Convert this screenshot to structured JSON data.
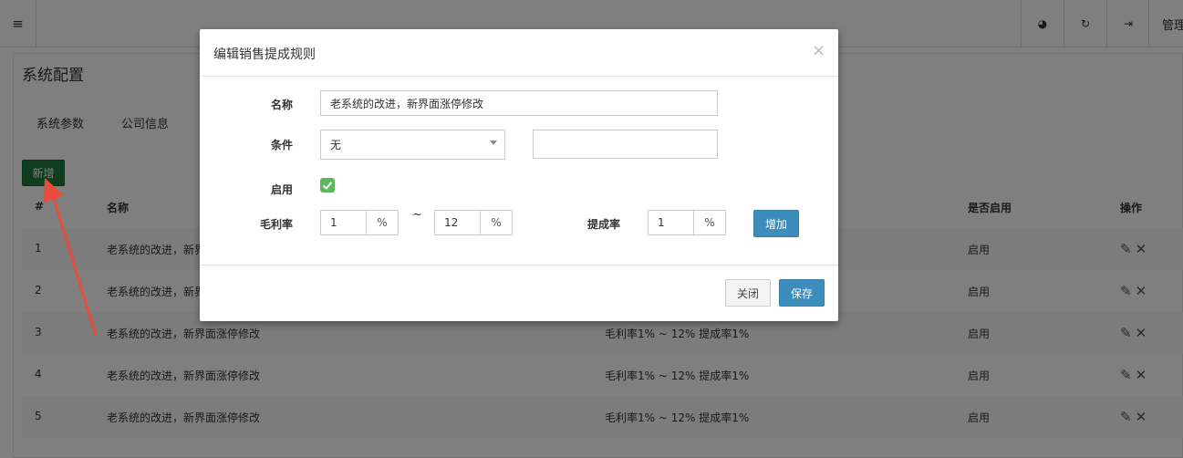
{
  "topbar": {
    "menu_icon": "menu-icon",
    "buttons": [
      {
        "icon": "pie-chart-icon",
        "glyph": "◕"
      },
      {
        "icon": "refresh-icon",
        "glyph": "↻"
      },
      {
        "icon": "logout-icon",
        "glyph": "⇥"
      }
    ],
    "admin_label": "管理"
  },
  "page": {
    "title": "系统配置",
    "tabs": [
      "系统参数",
      "公司信息"
    ],
    "add_button": "新增"
  },
  "table": {
    "headers": {
      "index": "#",
      "name": "名称",
      "enabled": "是否启用",
      "actions": "操作"
    },
    "rows": [
      {
        "index": "1",
        "name": "老系统的改进，新界面涨停修改",
        "rule": "",
        "enabled": "启用"
      },
      {
        "index": "2",
        "name": "老系统的改进，新界面涨停修改",
        "rule": "",
        "enabled": "启用"
      },
      {
        "index": "3",
        "name": "老系统的改进，新界面涨停修改",
        "rule": "毛利率1% ~ 12% 提成率1%",
        "enabled": "启用"
      },
      {
        "index": "4",
        "name": "老系统的改进，新界面涨停修改",
        "rule": "毛利率1% ~ 12% 提成率1%",
        "enabled": "启用"
      },
      {
        "index": "5",
        "name": "老系统的改进，新界面涨停修改",
        "rule": "毛利率1% ~ 12% 提成率1%",
        "enabled": "启用"
      }
    ],
    "edit_icon": "edit-icon",
    "delete_icon": "delete-icon"
  },
  "modal": {
    "title": "编辑销售提成规则",
    "close_glyph": "×",
    "name_label": "名称",
    "name_value": "老系统的改进，新界面涨停修改",
    "condition_label": "条件",
    "condition_value": "无",
    "condition_extra": "",
    "enabled_label": "启用",
    "enabled_checked": true,
    "margin_label": "毛利率",
    "margin_from": "1",
    "margin_to": "12",
    "percent": "%",
    "tilde": "~",
    "commission_label": "提成率",
    "commission_value": "1",
    "add_button": "增加",
    "close_button": "关闭",
    "save_button": "保存"
  },
  "colors": {
    "primary": "#3c8dbc",
    "success": "#1f7a3d",
    "check": "#5cb85c",
    "annotation_arrow": "#e74c3c"
  }
}
